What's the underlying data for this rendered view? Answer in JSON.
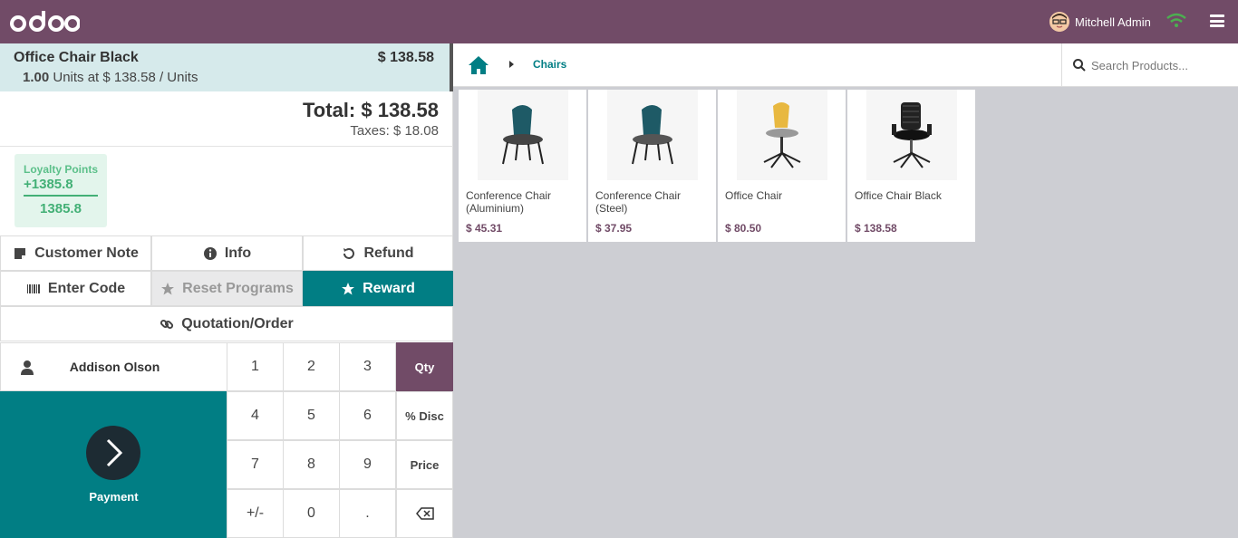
{
  "topbar": {
    "logo_text": "odoo",
    "user_name": "Mitchell Admin"
  },
  "order": {
    "line": {
      "product": "Office Chair Black",
      "price": "$ 138.58",
      "qty": "1.00",
      "unit_info": "Units at $ 138.58 / Units"
    },
    "total": "Total: $ 138.58",
    "taxes": "Taxes: $ 18.08"
  },
  "loyalty": {
    "title": "Loyalty Points",
    "won": "+1385.8",
    "balance": "1385.8"
  },
  "controls": {
    "customer_note": "Customer Note",
    "info": "Info",
    "refund": "Refund",
    "enter_code": "Enter Code",
    "reset_programs": "Reset Programs",
    "reward": "Reward",
    "quotation": "Quotation/Order"
  },
  "customer": {
    "name": "Addison Olson"
  },
  "numpad": {
    "keys": [
      "1",
      "2",
      "3",
      "4",
      "5",
      "6",
      "7",
      "8",
      "9",
      "+/-",
      "0",
      "."
    ],
    "modes": [
      "Qty",
      "% Disc",
      "Price"
    ],
    "active_mode": "Qty"
  },
  "payment": {
    "label": "Payment"
  },
  "products_panel": {
    "breadcrumb": "Chairs",
    "search_placeholder": "Search Products..."
  },
  "products": [
    {
      "name": "Conference Chair (Aluminium)",
      "price": "$ 45.31",
      "image": "teal-chair-aluminium"
    },
    {
      "name": "Conference Chair (Steel)",
      "price": "$ 37.95",
      "image": "teal-chair-steel"
    },
    {
      "name": "Office Chair",
      "price": "$ 80.50",
      "image": "yellow-office-chair"
    },
    {
      "name": "Office Chair Black",
      "price": "$ 138.58",
      "image": "black-mesh-office-chair"
    }
  ],
  "colors": {
    "brand": "#714B67",
    "teal": "#017E84",
    "selected_line": "#D6EAEB",
    "loyalty_green": "#43B076"
  }
}
